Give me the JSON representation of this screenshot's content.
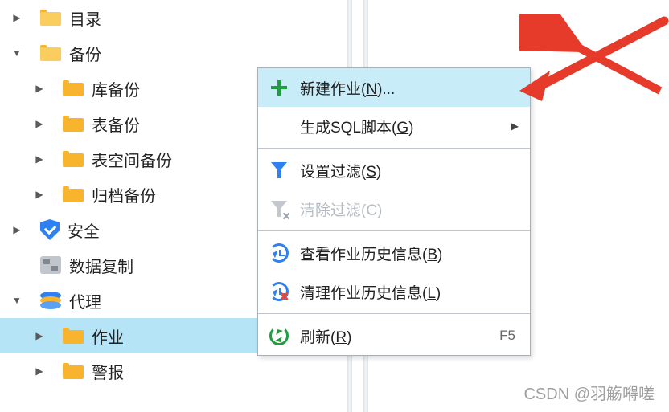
{
  "tree": {
    "catalog": "目录",
    "backup": "备份",
    "backup_children": {
      "db_backup": "库备份",
      "table_backup": "表备份",
      "tablespace_backup": "表空间备份",
      "archive_backup": "归档备份"
    },
    "security": "安全",
    "replication": "数据复制",
    "agent": "代理",
    "agent_children": {
      "jobs": "作业",
      "alerts": "警报"
    }
  },
  "menu": {
    "new_job": {
      "label": "新建作业(",
      "hotkey": "N",
      "suffix": ")..."
    },
    "gen_sql": {
      "label": "生成SQL脚本(",
      "hotkey": "G",
      "suffix": ")"
    },
    "set_filter": {
      "label": "设置过滤(",
      "hotkey": "S",
      "suffix": ")"
    },
    "clear_filter": {
      "label": "清除过滤(C)"
    },
    "view_history": {
      "label": "查看作业历史信息(",
      "hotkey": "B",
      "suffix": ")"
    },
    "clear_history": {
      "label": "清理作业历史信息(",
      "hotkey": "L",
      "suffix": ")"
    },
    "refresh": {
      "label": "刷新(",
      "hotkey": "R",
      "suffix": ")",
      "shortcut": "F5"
    }
  },
  "watermark": "CSDN @羽觞嘚嗟"
}
